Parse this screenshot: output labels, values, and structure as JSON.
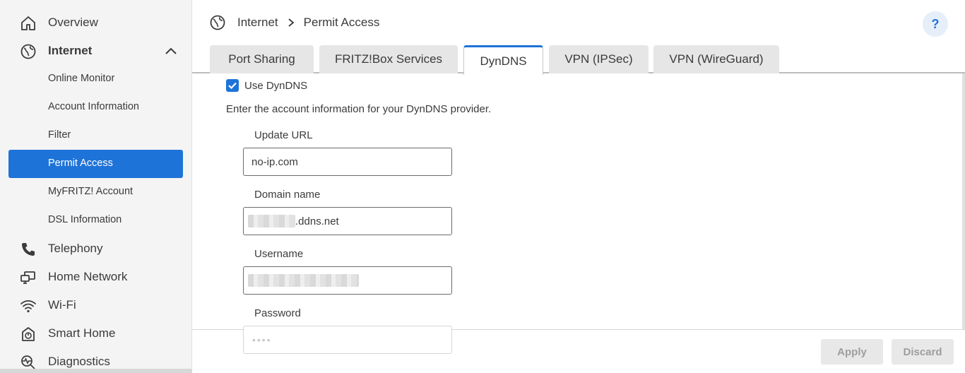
{
  "sidebar": {
    "overview": "Overview",
    "internet": "Internet",
    "sub_items": [
      "Online Monitor",
      "Account Information",
      "Filter",
      "Permit Access",
      "MyFRITZ! Account",
      "DSL Information"
    ],
    "telephony": "Telephony",
    "home_network": "Home Network",
    "wifi": "Wi-Fi",
    "smart_home": "Smart Home",
    "diagnostics": "Diagnostics"
  },
  "breadcrumb": {
    "parent": "Internet",
    "current": "Permit Access"
  },
  "help": "?",
  "tabs": [
    "Port Sharing",
    "FRITZ!Box Services",
    "DynDNS",
    "VPN (IPSec)",
    "VPN (WireGuard)"
  ],
  "active_tab": "DynDNS",
  "form": {
    "use_dyndns_label": "Use DynDNS",
    "use_dyndns_checked": true,
    "intro": "Enter the account information for your DynDNS provider.",
    "update_url_label": "Update URL",
    "update_url_value": "no-ip.com",
    "domain_label": "Domain name",
    "domain_suffix": ".ddns.net",
    "username_label": "Username",
    "password_label": "Password",
    "password_value": "••••"
  },
  "footer": {
    "apply": "Apply",
    "discard": "Discard"
  },
  "colors": {
    "accent": "#1e73d8",
    "sidebar_bg": "#f4f4f4"
  }
}
